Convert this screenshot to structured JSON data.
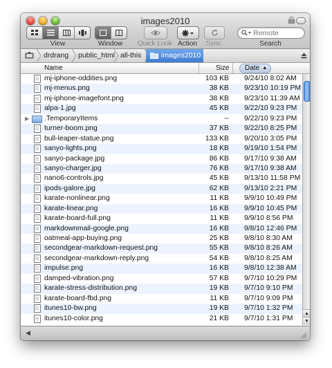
{
  "window": {
    "title": "images2010"
  },
  "toolbar": {
    "view_label": "View",
    "window_label": "Window",
    "quicklook_label": "Quick Look",
    "action_label": "Action",
    "sync_label": "Sync",
    "search_label": "Search",
    "search_placeholder": "Remote"
  },
  "breadcrumbs": [
    "drdrang",
    "public_html",
    "all-this",
    "images2010"
  ],
  "columns": {
    "name": "Name",
    "size": "Size",
    "date": "Date"
  },
  "files": [
    {
      "name": "mj-iphone-oddities.png",
      "size": "103 KB",
      "date": "9/24/10 8:02 AM",
      "kind": "file"
    },
    {
      "name": "mj-menus.png",
      "size": "38 KB",
      "date": "9/23/10 10:19 PM",
      "kind": "file"
    },
    {
      "name": "mj-iphone-imagefont.png",
      "size": "38 KB",
      "date": "9/23/10 11:39 AM",
      "kind": "file"
    },
    {
      "name": "alpa-1.jpg",
      "size": "45 KB",
      "date": "9/22/10 9:23 PM",
      "kind": "file"
    },
    {
      "name": ".TemporaryItems",
      "size": "--",
      "date": "9/22/10 9:23 PM",
      "kind": "folder"
    },
    {
      "name": "turner-boom.png",
      "size": "37 KB",
      "date": "9/22/10 8:25 PM",
      "kind": "file"
    },
    {
      "name": "bull-leaper-statue.png",
      "size": "133 KB",
      "date": "9/20/10 3:05 PM",
      "kind": "file"
    },
    {
      "name": "sanyo-lights.png",
      "size": "18 KB",
      "date": "9/19/10 1:54 PM",
      "kind": "file"
    },
    {
      "name": "sanyo-package.jpg",
      "size": "86 KB",
      "date": "9/17/10 9:38 AM",
      "kind": "file"
    },
    {
      "name": "sanyo-charger.jpg",
      "size": "76 KB",
      "date": "9/17/10 9:38 AM",
      "kind": "file"
    },
    {
      "name": "nano6-controls.jpg",
      "size": "45 KB",
      "date": "9/13/10 11:58 PM",
      "kind": "file"
    },
    {
      "name": "ipods-galore.jpg",
      "size": "62 KB",
      "date": "9/13/10 2:21 PM",
      "kind": "file"
    },
    {
      "name": "karate-nonlinear.png",
      "size": "11 KB",
      "date": "9/9/10 10:49 PM",
      "kind": "file"
    },
    {
      "name": "karate-linear.png",
      "size": "16 KB",
      "date": "9/9/10 10:45 PM",
      "kind": "file"
    },
    {
      "name": "karate-board-full.png",
      "size": "11 KB",
      "date": "9/9/10 8:56 PM",
      "kind": "file"
    },
    {
      "name": "markdownmail-google.png",
      "size": "16 KB",
      "date": "9/8/10 12:46 PM",
      "kind": "file"
    },
    {
      "name": "oatmeal-app-buying.png",
      "size": "25 KB",
      "date": "9/8/10 8:30 AM",
      "kind": "file"
    },
    {
      "name": "secondgear-markdown-request.png",
      "size": "55 KB",
      "date": "9/8/10 8:26 AM",
      "kind": "file"
    },
    {
      "name": "secondgear-markdown-reply.png",
      "size": "54 KB",
      "date": "9/8/10 8:25 AM",
      "kind": "file"
    },
    {
      "name": "impulse.png",
      "size": "16 KB",
      "date": "9/8/10 12:38 AM",
      "kind": "file"
    },
    {
      "name": "damped-vibration.png",
      "size": "57 KB",
      "date": "9/7/10 10:29 PM",
      "kind": "file"
    },
    {
      "name": "karate-stress-distribution.png",
      "size": "19 KB",
      "date": "9/7/10 9:10 PM",
      "kind": "file"
    },
    {
      "name": "karate-board-fbd.png",
      "size": "11 KB",
      "date": "9/7/10 9:09 PM",
      "kind": "file"
    },
    {
      "name": "itunes10-bw.png",
      "size": "19 KB",
      "date": "9/7/10 1:32 PM",
      "kind": "file"
    },
    {
      "name": "itunes10-color.png",
      "size": "21 KB",
      "date": "9/7/10 1:31 PM",
      "kind": "file"
    }
  ],
  "colors": {
    "selection_blue": "#3e7cd2",
    "stripe": "#edf3fe",
    "scroll_thumb": "#5f9ae6"
  }
}
